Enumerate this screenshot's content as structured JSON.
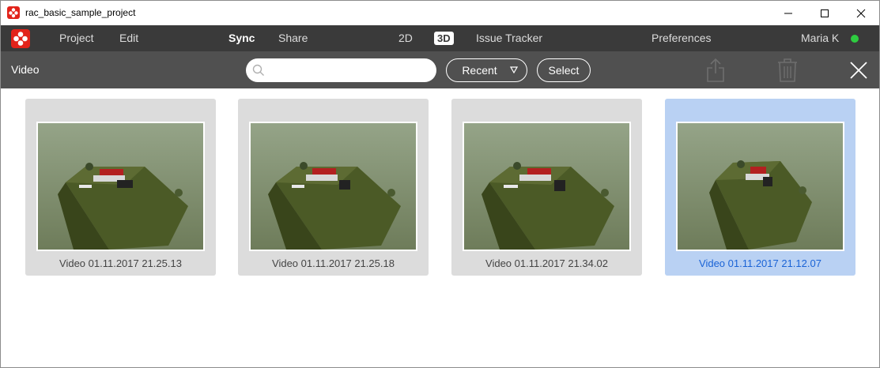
{
  "window": {
    "title": "rac_basic_sample_project"
  },
  "menubar": {
    "items": [
      {
        "label": "Project"
      },
      {
        "label": "Edit"
      },
      {
        "label": "Sync"
      },
      {
        "label": "Share"
      },
      {
        "label": "2D"
      },
      {
        "label": "3D"
      },
      {
        "label": "Issue Tracker"
      },
      {
        "label": "Preferences"
      },
      {
        "label": "Maria K"
      }
    ],
    "active_item": "Sync",
    "status_color": "#2ecc40"
  },
  "toolbar": {
    "section_label": "Video",
    "search_value": "",
    "sort_label": "Recent",
    "select_label": "Select",
    "icons": [
      "share-icon",
      "trash-icon",
      "close-icon"
    ]
  },
  "videos": [
    {
      "caption": "Video 01.11.2017 21.25.13",
      "selected": false
    },
    {
      "caption": "Video 01.11.2017 21.25.18",
      "selected": false
    },
    {
      "caption": "Video 01.11.2017 21.34.02",
      "selected": false
    },
    {
      "caption": "Video 01.11.2017 21.12.07",
      "selected": true
    }
  ],
  "colors": {
    "accent": "#e2231a",
    "selection": "#b9d1f3",
    "selected_text": "#1a63d6"
  }
}
